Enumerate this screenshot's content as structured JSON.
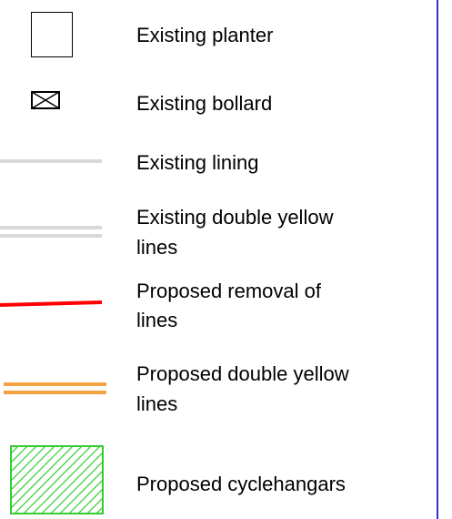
{
  "legend": {
    "items": [
      {
        "symbol": "existing-planter-symbol",
        "label": "Existing planter"
      },
      {
        "symbol": "existing-bollard-symbol",
        "label": "Existing bollard"
      },
      {
        "symbol": "existing-lining-symbol",
        "label": "Existing lining"
      },
      {
        "symbol": "existing-double-yellow-lines-symbol",
        "label_line1": "Existing double yellow",
        "label_line2": "lines"
      },
      {
        "symbol": "proposed-removal-of-lines-symbol",
        "label_line1": "Proposed removal of",
        "label_line2": "lines"
      },
      {
        "symbol": "proposed-double-yellow-lines-symbol",
        "label_line1": "Proposed double yellow",
        "label_line2": "lines"
      },
      {
        "symbol": "proposed-cyclehangars-symbol",
        "label": "Proposed cyclehangars"
      }
    ]
  },
  "colors": {
    "existing_lines": "#d9d9d9",
    "removal_line": "#ff0000",
    "proposed_double_yellow": "#f5a243",
    "cyclehangar_hatch": "#33cc33",
    "border": "#3333cc"
  }
}
